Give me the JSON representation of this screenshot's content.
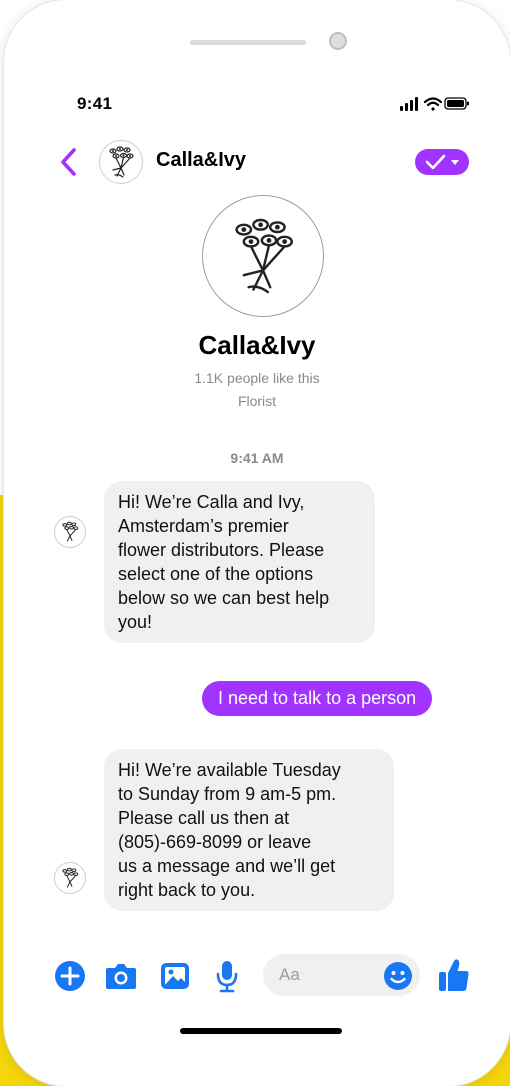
{
  "status_bar": {
    "time": "9:41"
  },
  "header": {
    "title": "Calla&Ivy",
    "back_icon": "chevron-left-icon",
    "action_icon": "checkmark-dropdown-icon"
  },
  "profile": {
    "name": "Calla&Ivy",
    "likes": "1.1K people like this",
    "category": "Florist"
  },
  "conversation": {
    "timestamp": "9:41 AM",
    "messages": [
      {
        "sender": "page",
        "lines": [
          "Hi! We’re Calla and Ivy,",
          "Amsterdam’s premier",
          "flower distributors. Please",
          "select one of the options",
          "below so we can best help",
          "you!"
        ]
      },
      {
        "sender": "user",
        "text": "I need to talk to a person"
      },
      {
        "sender": "page",
        "lines": [
          "Hi! We’re available Tuesday",
          "to Sunday from 9 am-5 pm.",
          "Please call us then at",
          "(805)-669-8099 or leave",
          "us a message and we’ll get",
          "right back to you."
        ]
      }
    ]
  },
  "composer": {
    "placeholder": "Aa",
    "icons": [
      "plus-icon",
      "camera-icon",
      "gallery-icon",
      "microphone-icon",
      "emoji-icon",
      "thumbs-up-icon"
    ]
  },
  "colors": {
    "accent_purple": "#a033ff",
    "messenger_blue": "#1877f2",
    "incoming_bubble": "#f0f0f0",
    "background_yellow": "#f5d60a"
  }
}
